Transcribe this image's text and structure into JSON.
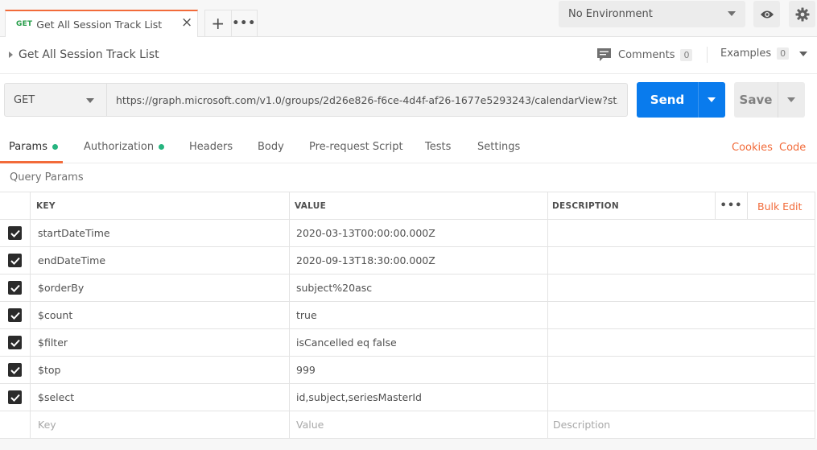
{
  "tab": {
    "method": "GET",
    "name": "Get All Session Track List",
    "close": "×",
    "add": "+",
    "more": "•••"
  },
  "environment": {
    "selected": "No Environment"
  },
  "request": {
    "title": "Get All Session Track List",
    "comments_label": "Comments",
    "comments_count": "0",
    "examples_label": "Examples",
    "examples_count": "0",
    "method": "GET",
    "url": "https://graph.microsoft.com/v1.0/groups/2d26e826-f6ce-4d4f-af26-1677e5293243/calendarView?st...",
    "send_label": "Send",
    "save_label": "Save"
  },
  "subtabs": [
    {
      "label": "Params",
      "dot": true,
      "active": true
    },
    {
      "label": "Authorization",
      "dot": true
    },
    {
      "label": "Headers"
    },
    {
      "label": "Body"
    },
    {
      "label": "Pre-request Script"
    },
    {
      "label": "Tests"
    },
    {
      "label": "Settings"
    }
  ],
  "links": {
    "cookies": "Cookies",
    "code": "Code"
  },
  "query_params": {
    "section_label": "Query Params",
    "headers": {
      "key": "KEY",
      "value": "VALUE",
      "description": "DESCRIPTION",
      "more": "•••",
      "bulk_edit": "Bulk Edit"
    },
    "rows": [
      {
        "key": "startDateTime",
        "value": "2020-03-13T00:00:00.000Z",
        "description": "",
        "checked": true
      },
      {
        "key": "endDateTime",
        "value": "2020-09-13T18:30:00.000Z",
        "description": "",
        "checked": true
      },
      {
        "key": "$orderBy",
        "value": "subject%20asc",
        "description": "",
        "checked": true
      },
      {
        "key": "$count",
        "value": "true",
        "description": "",
        "checked": true
      },
      {
        "key": "$filter",
        "value": "isCancelled eq false",
        "description": "",
        "checked": true
      },
      {
        "key": "$top",
        "value": "999",
        "description": "",
        "checked": true
      },
      {
        "key": "$select",
        "value": "id,subject,seriesMasterId",
        "description": "",
        "checked": true
      }
    ],
    "placeholders": {
      "key": "Key",
      "value": "Value",
      "description": "Description"
    }
  },
  "colors": {
    "accent": "#f26b3a",
    "send": "#097bed",
    "get_method": "#249c47",
    "status_dot": "#26b47f"
  },
  "icons": [
    "close-icon",
    "plus-icon",
    "more-icon",
    "chevron-down-icon",
    "eye-icon",
    "gear-icon",
    "comment-icon",
    "caret-right-icon",
    "checkbox-checked-icon"
  ]
}
